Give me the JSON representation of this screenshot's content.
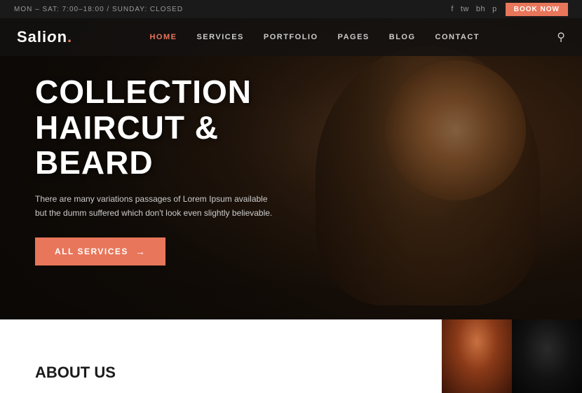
{
  "topbar": {
    "hours": "MON – SAT: 7:00–18:00  /  SUNDAY: CLOSED",
    "book_now": "BOOK NOW",
    "social": [
      "f",
      "tw",
      "bh",
      "p"
    ]
  },
  "header": {
    "logo": "Salion.",
    "nav_items": [
      {
        "label": "HOME",
        "active": true
      },
      {
        "label": "SERVICES",
        "active": false
      },
      {
        "label": "PORTFOLIO",
        "active": false
      },
      {
        "label": "PAGES",
        "active": false
      },
      {
        "label": "BLOG",
        "active": false
      },
      {
        "label": "CONTACT",
        "active": false
      }
    ]
  },
  "hero": {
    "title_line1": "COLLECTION",
    "title_line2": "HAIRCUT & BEARD",
    "subtitle": "There are many variations passages of Lorem Ipsum available but the dumm suffered which don't look even slightly believable.",
    "cta_label": "All Services"
  },
  "below": {
    "about_label": "About Us"
  },
  "colors": {
    "accent": "#e8765a",
    "dark": "#1a1a1a",
    "nav_active": "#e8765a"
  }
}
